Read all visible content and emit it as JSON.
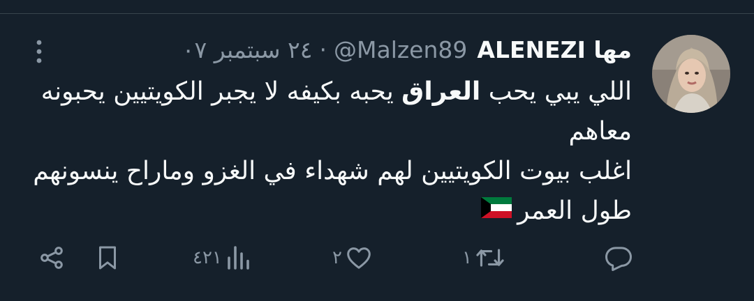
{
  "tweet": {
    "display_name": "مها ALENEZI",
    "handle": "@Malzen89",
    "separator": "·",
    "date": "٢٤ سبتمبر ٠٧",
    "body": {
      "line1_before": "اللي يبي يحب ",
      "line1_bold": "العراق",
      "line1_after": " يحبه بكيفه لا يجبر الكويتيين يحبونه",
      "line2": "معاهم",
      "line3": "اغلب بيوت الكويتيين لهم شهداء في الغزو وماراح ينسونهم",
      "line4": "طول العمر"
    },
    "flag_icon": "kuwait-flag-emoji"
  },
  "actions": {
    "reply_count": "",
    "retweet_count": "١",
    "like_count": "٢",
    "views_count": "٤٢١"
  },
  "colors": {
    "background": "#15202b",
    "text_primary": "#f7f9f9",
    "text_secondary": "#8b98a5",
    "divider": "#38444d"
  }
}
